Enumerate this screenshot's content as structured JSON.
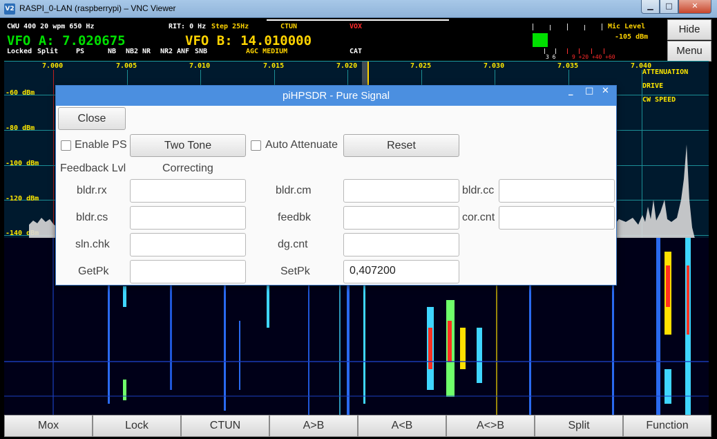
{
  "window": {
    "icon": "V2",
    "title": "RASPI_0-LAN (raspberrypi) – VNC Viewer",
    "min_icon": "minimize-icon",
    "max_icon": "maximize-icon",
    "close_icon": "close-icon"
  },
  "status": {
    "mode": "CWU 400 20 wpm 650 Hz",
    "rit": "RIT: 0 Hz",
    "step": "Step 25Hz",
    "ctun": "CTUN",
    "vox": "VOX",
    "vfo_a": "VFO A: 7.020675",
    "vfo_b": "VFO B: 14.010000",
    "locked": "Locked",
    "split": "Split",
    "ps": "PS",
    "nb": "NB",
    "nb2": "NB2",
    "nr": "NR",
    "nr2": "NR2",
    "anf": "ANF",
    "snb": "SNB",
    "agc": "AGC MEDIUM",
    "cat": "CAT",
    "mic_level": "Mic Level",
    "dbm": "-105 dBm",
    "scale_white": "3  6",
    "scale_red": "9 +20 +40 +60"
  },
  "side_buttons": {
    "hide": "Hide",
    "menu": "Menu"
  },
  "panadapter": {
    "freqs": [
      "7.000",
      "7.005",
      "7.010",
      "7.015",
      "7.020",
      "7.025",
      "7.030",
      "7.035",
      "7.040"
    ],
    "db_labels": [
      "-60 dBm",
      "-80 dBm",
      "-100 dBm",
      "-120 dBm",
      "-140 dBm"
    ],
    "right_info": [
      "ATTENUATION",
      "DRIVE",
      "CW SPEED"
    ]
  },
  "bottom_buttons": [
    "Mox",
    "Lock",
    "CTUN",
    "A>B",
    "A<B",
    "A<>B",
    "Split",
    "Function"
  ],
  "dialog": {
    "title": "piHPSDR - Pure Signal",
    "close_btn": "Close",
    "enable_ps": "Enable PS",
    "two_tone": "Two Tone",
    "auto_attenuate": "Auto Attenuate",
    "reset": "Reset",
    "feedback_lvl": "Feedback Lvl",
    "correcting": "Correcting",
    "fields": {
      "bldr_rx": {
        "label": "bldr.rx",
        "value": ""
      },
      "bldr_cm": {
        "label": "bldr.cm",
        "value": ""
      },
      "bldr_cc": {
        "label": "bldr.cc",
        "value": ""
      },
      "bldr_cs": {
        "label": "bldr.cs",
        "value": ""
      },
      "feedbk": {
        "label": "feedbk",
        "value": ""
      },
      "cor_cnt": {
        "label": "cor.cnt",
        "value": ""
      },
      "sln_chk": {
        "label": "sln.chk",
        "value": ""
      },
      "dg_cnt": {
        "label": "dg.cnt",
        "value": ""
      },
      "getpk": {
        "label": "GetPk",
        "value": ""
      },
      "setpk": {
        "label": "SetPk",
        "value": "0,407200"
      }
    }
  }
}
